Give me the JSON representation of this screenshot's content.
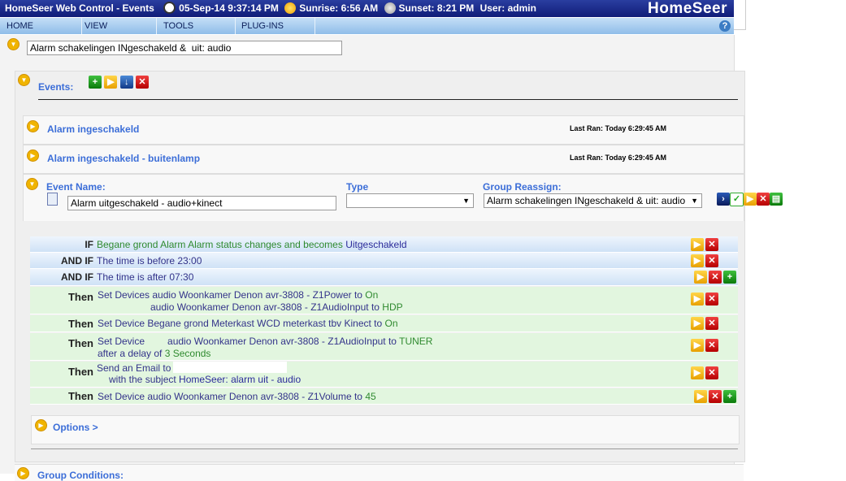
{
  "header": {
    "title": "HomeSeer Web Control - Events",
    "datetime": "05-Sep-14 9:37:14 PM",
    "sunrise": "Sunrise: 6:56 AM",
    "sunset": "Sunset: 8:21 PM",
    "user": "User: admin",
    "logo": "HomeSeer"
  },
  "nav": {
    "items": [
      {
        "label": "HOME"
      },
      {
        "label": "VIEW"
      },
      {
        "label": "TOOLS"
      },
      {
        "label": "PLUG-INS"
      }
    ],
    "help": "?"
  },
  "group": {
    "name": "Alarm schakelingen INgeschakeld &  uit: audio"
  },
  "events_panel": {
    "label": "Events:"
  },
  "events": [
    {
      "name": "Alarm ingeschakeld",
      "last_ran": "Last Ran: Today 6:29:45 AM"
    },
    {
      "name": "Alarm ingeschakeld - buitenlamp",
      "last_ran": "Last Ran: Today 6:29:45 AM"
    }
  ],
  "editor": {
    "event_name_label": "Event Name:",
    "event_name": "Alarm uitgeschakeld - audio+kinect",
    "type_label": "Type",
    "type_value": "",
    "group_label": "Group Reassign:",
    "group_value": "Alarm schakelingen INgeschakeld & uit: audio"
  },
  "conditions": [
    {
      "kw": "IF",
      "pre": "Begane grond Alarm Alarm status changes and becomes ",
      "val": "Uitgeschakeld"
    },
    {
      "kw": "AND IF",
      "pre": "The time is before 23:00",
      "val": ""
    },
    {
      "kw": "AND IF",
      "pre": "The time is after 07:30",
      "val": ""
    }
  ],
  "actions": [
    {
      "kw": "Then",
      "a": "Set Devices",
      "l1": "audio Woonkamer Denon avr-3808 - Z1Power to ",
      "v1": "On",
      "l2": "audio Woonkamer Denon avr-3808 - Z1AudioInput to ",
      "v2": "HDP"
    },
    {
      "kw": "Then",
      "a": "Set Device",
      "l1": "Begane grond Meterkast WCD meterkast tbv Kinect to ",
      "v1": "On"
    },
    {
      "kw": "Then",
      "a": "Set Device",
      "l1": "audio Woonkamer Denon avr-3808 - Z1AudioInput to ",
      "v1": "TUNER",
      "l2": "after a delay of ",
      "v2": "3 Seconds"
    },
    {
      "kw": "Then",
      "a": "Send an Email to",
      "l2": "with the subject ",
      "v2": "HomeSeer: alarm uit - audio"
    },
    {
      "kw": "Then",
      "a": "Set Device",
      "l1": "audio Woonkamer Denon avr-3808 - Z1Volume to ",
      "v1": "45"
    }
  ],
  "options": {
    "label": "Options >"
  },
  "next_group": {
    "label": "Group Conditions:"
  }
}
